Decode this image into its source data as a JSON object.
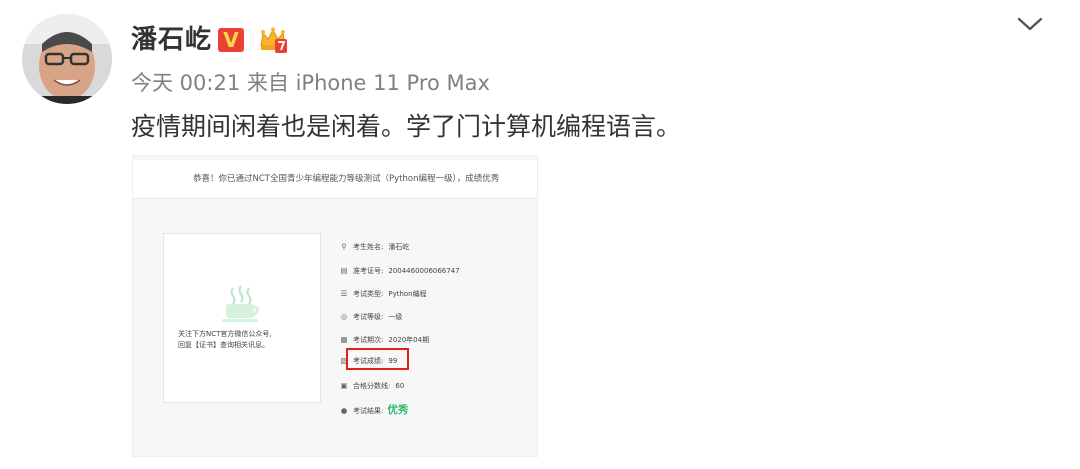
{
  "post": {
    "username": "潘石屹",
    "verified_badge": "V",
    "timestamp": "今天 00:21",
    "source": "来自 iPhone 11 Pro Max",
    "text": "疫情期间闲着也是闲着。学了门计算机编程语言。"
  },
  "icons": {
    "avatar": "avatar-photo",
    "verified": "verified-v-badge",
    "member": "crown-member-icon",
    "menu": "chevron-down-icon"
  },
  "screenshot": {
    "banner": "恭喜！你已通过NCT全国青少年编程能力等级测试（Python编程一级），成绩优秀",
    "qr_text_line1": "关注下方NCT官方微信公众号,",
    "qr_text_line2": "回复【证书】查询相关讯息。",
    "fields": [
      {
        "label": "考生姓名:",
        "value": "潘石屹",
        "icon": "person-icon"
      },
      {
        "label": "准考证号:",
        "value": "2004460006066747",
        "icon": "id-card-icon"
      },
      {
        "label": "考试类型:",
        "value": "Python编程",
        "icon": "list-icon"
      },
      {
        "label": "考试等级:",
        "value": "一级",
        "icon": "level-icon"
      },
      {
        "label": "考试期次:",
        "value": "2020年04期",
        "icon": "calendar-icon"
      },
      {
        "label": "考试成绩:",
        "value": "99",
        "icon": "score-icon"
      },
      {
        "label": "合格分数线:",
        "value": "60",
        "icon": "pass-line-icon"
      },
      {
        "label": "考试结果:",
        "value": "优秀",
        "icon": "result-icon"
      }
    ]
  },
  "colors": {
    "text": "#333333",
    "meta": "#808080",
    "verified_bg": "#e94234",
    "highlight_box": "#e0201b",
    "excellent": "#31b86a"
  }
}
